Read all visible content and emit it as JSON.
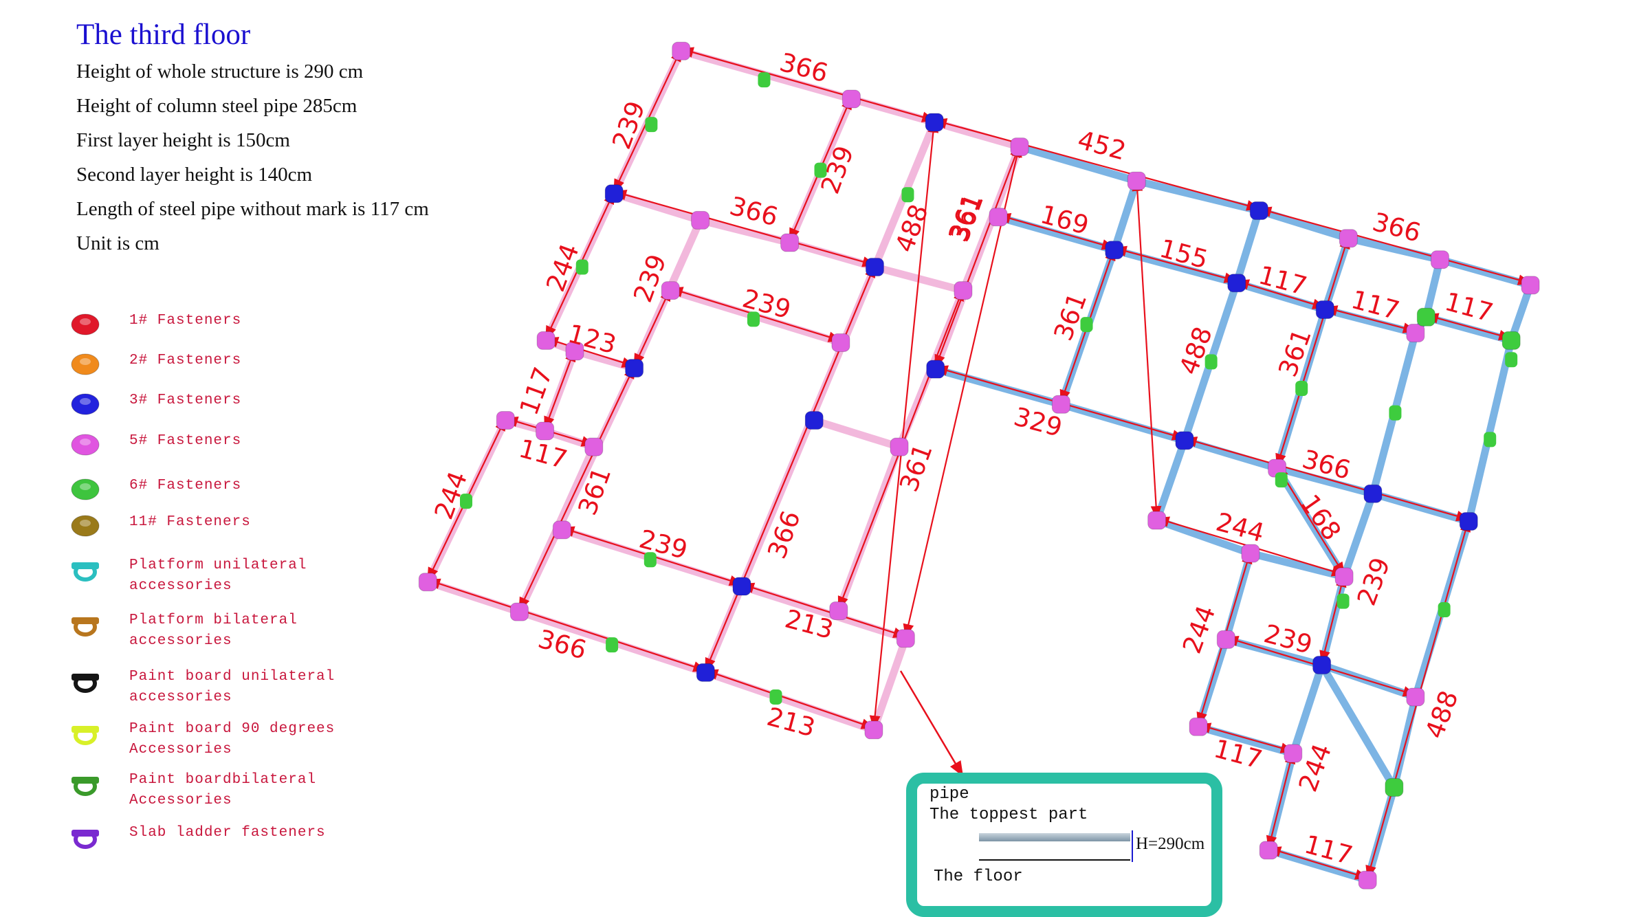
{
  "header": {
    "title": "The third floor",
    "specs": [
      "Height of whole structure is 290 cm",
      "Height of column steel pipe 285cm",
      "First layer  height is 150cm",
      "Second layer  height is 140cm",
      "Length of steel pipe without mark is 117 cm",
      "Unit is cm"
    ]
  },
  "legend": [
    {
      "icon": "fastener-1-icon",
      "label": "1# Fasteners",
      "color": "#e0182a"
    },
    {
      "icon": "fastener-2-icon",
      "label": "2# Fasteners",
      "color": "#f08a1c"
    },
    {
      "icon": "fastener-3-icon",
      "label": "3# Fasteners",
      "color": "#2222dd"
    },
    {
      "icon": "fastener-5-icon",
      "label": "5# Fasteners",
      "color": "#e055e0"
    },
    {
      "icon": "fastener-6-icon",
      "label": "6# Fasteners",
      "color": "#3ec43e"
    },
    {
      "icon": "fastener-11-icon",
      "label": "11# Fasteners",
      "color": "#9a7a1a"
    },
    {
      "icon": "platform-unilateral-icon",
      "label": "Platform unilateral\naccessories",
      "color": "#2bbfc0"
    },
    {
      "icon": "platform-bilateral-icon",
      "label": "Platform bilateral\naccessories",
      "color": "#b8761e"
    },
    {
      "icon": "paint-board-unilateral-icon",
      "label": "Paint board unilateral\naccessories",
      "color": "#151515"
    },
    {
      "icon": "paint-board-90-icon",
      "label": "Paint board 90 degrees\nAccessories",
      "color": "#d8f028"
    },
    {
      "icon": "paint-board-bilateral-icon",
      "label": "Paint boardbilateral\nAccessories",
      "color": "#3a9a2a"
    },
    {
      "icon": "slab-ladder-icon",
      "label": "Slab ladder fasteners",
      "color": "#7a2ad0"
    }
  ],
  "dimensions": {
    "d1": "366",
    "d2": "239",
    "d3": "239",
    "d4": "366",
    "d5": "488",
    "d6": "361",
    "d7": "452",
    "d8": "169",
    "d9": "155",
    "d10": "366",
    "d11": "117",
    "d12": "117",
    "d13": "117",
    "d14": "244",
    "d15": "239",
    "d16": "239",
    "d17": "123",
    "d18": "117",
    "d19": "117",
    "d20": "244",
    "d21": "361",
    "d22": "239",
    "d23": "366",
    "d24": "361",
    "d25": "213",
    "d26": "366",
    "d27": "213",
    "d28": "361",
    "d29": "329",
    "d30": "488",
    "d31": "361",
    "d32": "366",
    "d33": "168",
    "d34": "244",
    "d35": "239",
    "d36": "361",
    "d37": "244",
    "d38": "239",
    "d39": "117",
    "d40": "244",
    "d41": "488",
    "d42": "117"
  },
  "inset": {
    "line1": "pipe",
    "line2": "The toppest part",
    "height_label": "H=290cm",
    "floor_label": "The floor"
  },
  "colors": {
    "pink_pipe": "#f2b8dc",
    "blue_pipe": "#7cb4e4",
    "dimension": "#e8101c",
    "connector_pink": "#e060e0",
    "connector_blue": "#2020d8",
    "connector_green": "#3ecc3e",
    "inset_border": "#2bbfa4"
  }
}
